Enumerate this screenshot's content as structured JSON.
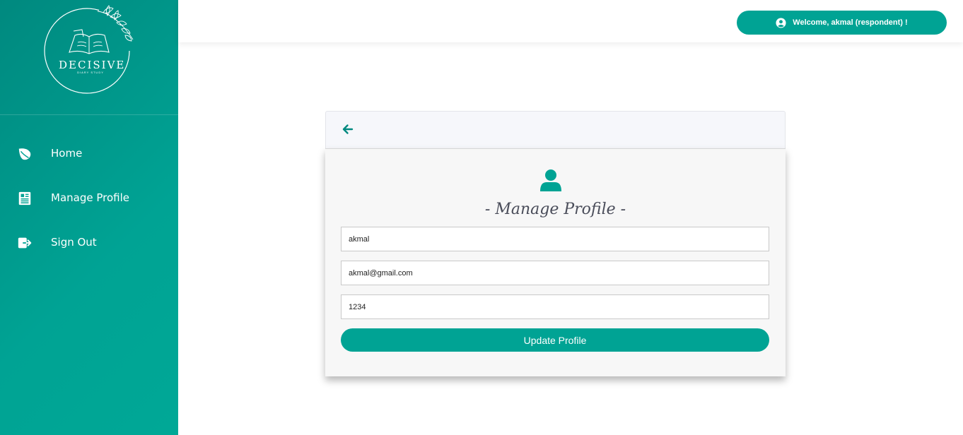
{
  "brand": {
    "name": "DECISIVE",
    "tagline": "DIARY STUDY",
    "color": "#00a394"
  },
  "sidebar": {
    "items": [
      {
        "label": "Home",
        "icon": "leaf-icon"
      },
      {
        "label": "Manage Profile",
        "icon": "document-icon"
      },
      {
        "label": "Sign Out",
        "icon": "sign-out-icon"
      }
    ]
  },
  "header": {
    "welcome_text": "Welcome, akmal (respondent) !",
    "icon": "user-circle-icon"
  },
  "profile_form": {
    "back_icon": "arrow-left-icon",
    "avatar_icon": "user-icon",
    "title": "- Manage Profile -",
    "username": "akmal",
    "email": "akmal@gmail.com",
    "password": "1234",
    "submit_label": "Update Profile"
  }
}
